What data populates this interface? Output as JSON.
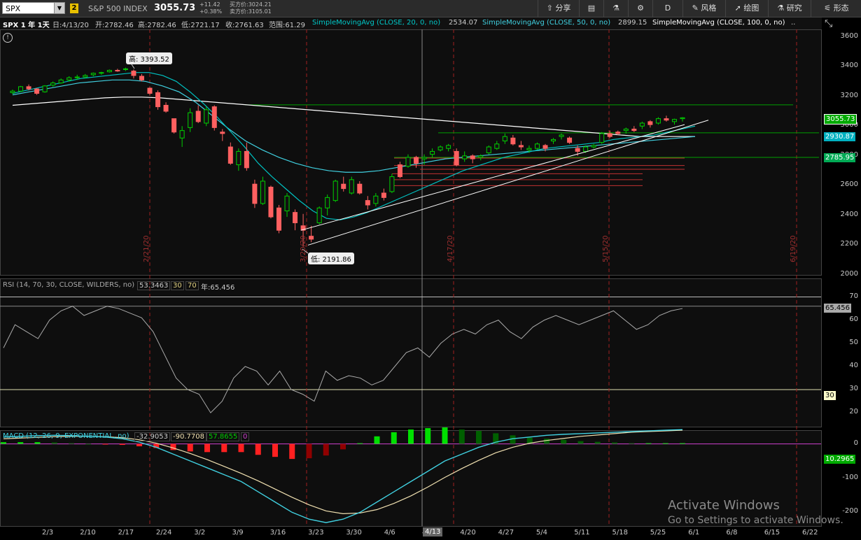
{
  "toolbar": {
    "symbol": "SPX",
    "link_badge": "2",
    "index_name": "S&P 500 INDEX",
    "last_price": "3055.73",
    "change": "+11.42",
    "change_pct": "+0.38%",
    "bid": "买方价:3024.21",
    "ask": "卖方价:3105.01",
    "share": "分享",
    "draw": "绘图",
    "pattern": "形态",
    "style": "风格",
    "research": "研究",
    "period": "D"
  },
  "header": {
    "title": "SPX 1 年 1天",
    "date": "日:4/13/20",
    "open": "开:2782.46",
    "high": "高:2782.46",
    "low": "低:2721.17",
    "close": "收:2761.63",
    "range": "范围:61.29",
    "sma20_label": "SimpleMovingAvg (CLOSE, 20, 0, no)",
    "sma20_value": "2534.07",
    "sma50_label": "SimpleMovingAvg (CLOSE, 50, 0, no)",
    "sma50_value": "2899.15",
    "sma100_label": "SimpleMovingAvg (CLOSE, 100, 0, no)",
    "more": ".."
  },
  "callouts": {
    "high": "高: 3393.52",
    "low": "低: 2191.86"
  },
  "price_axis": [
    "3600",
    "3400",
    "3200",
    "3000",
    "2800",
    "2600",
    "2400",
    "2200",
    "2000"
  ],
  "price_tags": {
    "last": "3055.73",
    "sma_a": "2930.87",
    "sma_b": "2785.95"
  },
  "event_dates": [
    "2/21/20",
    "3/20/20",
    "4/17/20",
    "5/15/20",
    "6/19/20"
  ],
  "rsi": {
    "label": "RSI (14, 70, 30, CLOSE, WILDERS, no)",
    "value": "53.3463",
    "os": "30",
    "ob": "70",
    "year": "年:65.456",
    "axis": [
      "70",
      "60",
      "50",
      "40",
      "30",
      "20"
    ],
    "tag_last": "65.456",
    "tag_os": "30"
  },
  "macd": {
    "label": "MACD (12, 26, 9, EXPONENTIAL, no)",
    "value": "-32.9053",
    "avg": "-90.7708",
    "diff": "57.8655",
    "zero": "0",
    "axis": [
      "0",
      "-100",
      "-200"
    ],
    "tag_last": "10.2965"
  },
  "x_axis": [
    "2/3",
    "2/10",
    "2/17",
    "2/24",
    "3/2",
    "3/9",
    "3/16",
    "3/23",
    "3/30",
    "4/6",
    "4/13",
    "4/20",
    "4/27",
    "5/4",
    "5/11",
    "5/18",
    "5/25",
    "6/1",
    "6/8",
    "6/15",
    "6/22"
  ],
  "watermark": {
    "line1": "Activate Windows",
    "line2": "Go to Settings to activate Windows."
  },
  "colors": {
    "up": "#00d000",
    "down": "#ff6060",
    "sma20": "#00c0c0",
    "sma50": "#40d0e0",
    "sma100": "#ffffff",
    "hline_green": "#00a000",
    "hline_red": "#c03030"
  },
  "chart_data": {
    "type": "candlestick",
    "ylim": [
      2000,
      3650
    ],
    "candles": [
      [
        3225,
        3245,
        3215,
        3235
      ],
      [
        3235,
        3270,
        3230,
        3265
      ],
      [
        3265,
        3280,
        3240,
        3250
      ],
      [
        3250,
        3255,
        3210,
        3220
      ],
      [
        3230,
        3275,
        3225,
        3270
      ],
      [
        3275,
        3300,
        3265,
        3290
      ],
      [
        3290,
        3320,
        3285,
        3310
      ],
      [
        3310,
        3335,
        3300,
        3325
      ],
      [
        3325,
        3345,
        3310,
        3330
      ],
      [
        3330,
        3350,
        3320,
        3340
      ],
      [
        3345,
        3360,
        3335,
        3355
      ],
      [
        3355,
        3365,
        3345,
        3360
      ],
      [
        3365,
        3380,
        3360,
        3375
      ],
      [
        3375,
        3385,
        3365,
        3370
      ],
      [
        3380,
        3393,
        3370,
        3385
      ],
      [
        3370,
        3380,
        3320,
        3340
      ],
      [
        3335,
        3350,
        3300,
        3310
      ],
      [
        3255,
        3260,
        3210,
        3220
      ],
      [
        3225,
        3240,
        3110,
        3130
      ],
      [
        3140,
        3160,
        3090,
        3100
      ],
      [
        3050,
        3050,
        2950,
        2960
      ],
      [
        2920,
        3000,
        2860,
        2970
      ],
      [
        2990,
        3120,
        2960,
        3090
      ],
      [
        3100,
        3140,
        3020,
        3030
      ],
      [
        3020,
        3130,
        3000,
        3110
      ],
      [
        3130,
        3140,
        2970,
        2990
      ],
      [
        2960,
        2980,
        2900,
        2950
      ],
      [
        2860,
        2890,
        2740,
        2750
      ],
      [
        2740,
        2850,
        2700,
        2830
      ],
      [
        2830,
        2890,
        2700,
        2720
      ],
      [
        2610,
        2640,
        2450,
        2480
      ],
      [
        2480,
        2660,
        2470,
        2630
      ],
      [
        2590,
        2600,
        2380,
        2390
      ],
      [
        2450,
        2470,
        2280,
        2300
      ],
      [
        2430,
        2550,
        2390,
        2530
      ],
      [
        2420,
        2440,
        2300,
        2350
      ],
      [
        2330,
        2410,
        2190,
        2300
      ],
      [
        2260,
        2330,
        2220,
        2240
      ],
      [
        2350,
        2460,
        2340,
        2450
      ],
      [
        2450,
        2540,
        2400,
        2520
      ],
      [
        2500,
        2640,
        2490,
        2630
      ],
      [
        2610,
        2660,
        2560,
        2580
      ],
      [
        2550,
        2660,
        2540,
        2640
      ],
      [
        2610,
        2630,
        2540,
        2550
      ],
      [
        2500,
        2530,
        2440,
        2470
      ],
      [
        2480,
        2550,
        2460,
        2530
      ],
      [
        2550,
        2580,
        2500,
        2520
      ],
      [
        2560,
        2680,
        2550,
        2660
      ],
      [
        2740,
        2760,
        2650,
        2660
      ],
      [
        2730,
        2810,
        2720,
        2790
      ],
      [
        2790,
        2800,
        2720,
        2750
      ],
      [
        2780,
        2810,
        2740,
        2790
      ],
      [
        2810,
        2850,
        2790,
        2830
      ],
      [
        2840,
        2870,
        2830,
        2860
      ],
      [
        2850,
        2880,
        2830,
        2870
      ],
      [
        2830,
        2850,
        2730,
        2740
      ],
      [
        2780,
        2830,
        2760,
        2800
      ],
      [
        2800,
        2810,
        2750,
        2780
      ],
      [
        2790,
        2810,
        2770,
        2800
      ],
      [
        2820,
        2870,
        2810,
        2860
      ],
      [
        2850,
        2900,
        2840,
        2880
      ],
      [
        2900,
        2950,
        2880,
        2930
      ],
      [
        2920,
        2940,
        2870,
        2880
      ],
      [
        2870,
        2900,
        2840,
        2860
      ],
      [
        2840,
        2870,
        2820,
        2850
      ],
      [
        2850,
        2890,
        2840,
        2880
      ],
      [
        2870,
        2880,
        2830,
        2850
      ],
      [
        2900,
        2920,
        2880,
        2910
      ],
      [
        2930,
        2950,
        2910,
        2940
      ],
      [
        2920,
        2930,
        2880,
        2890
      ],
      [
        2850,
        2870,
        2800,
        2830
      ],
      [
        2830,
        2870,
        2820,
        2860
      ],
      [
        2860,
        2880,
        2850,
        2870
      ],
      [
        2890,
        2960,
        2880,
        2950
      ],
      [
        2950,
        2970,
        2920,
        2930
      ],
      [
        2960,
        2970,
        2940,
        2950
      ],
      [
        2970,
        2990,
        2950,
        2980
      ],
      [
        2980,
        3000,
        2960,
        2970
      ],
      [
        3000,
        3030,
        2980,
        3020
      ],
      [
        3030,
        3040,
        2990,
        3010
      ],
      [
        3020,
        3060,
        3010,
        3050
      ],
      [
        3050,
        3070,
        3030,
        3040
      ],
      [
        3030,
        3050,
        3010,
        3045
      ],
      [
        3050,
        3060,
        3030,
        3056
      ]
    ],
    "sma20": [
      3220,
      3240,
      3260,
      3280,
      3300,
      3320,
      3330,
      3340,
      3350,
      3360,
      3360,
      3340,
      3300,
      3230,
      3150,
      3060,
      2960,
      2860,
      2750,
      2660,
      2580,
      2500,
      2430,
      2380,
      2370,
      2390,
      2420,
      2460,
      2500,
      2540,
      2580,
      2620,
      2660,
      2700,
      2730,
      2760,
      2790,
      2810,
      2830,
      2850,
      2860,
      2870,
      2880,
      2890,
      2910,
      2920,
      2930,
      2940,
      2960,
      2980,
      3000
    ],
    "sma50": [
      3210,
      3230,
      3250,
      3270,
      3290,
      3300,
      3310,
      3310,
      3300,
      3270,
      3230,
      3160,
      3070,
      2980,
      2900,
      2840,
      2790,
      2750,
      2720,
      2700,
      2690,
      2690,
      2700,
      2720,
      2740,
      2760,
      2780,
      2790,
      2800,
      2810,
      2820,
      2830,
      2840,
      2850,
      2860,
      2870,
      2880,
      2890,
      2900,
      2910,
      2920,
      2930
    ],
    "sma100": [
      3140,
      3150,
      3160,
      3170,
      3180,
      3190,
      3195,
      3195,
      3190,
      3180,
      3170,
      3160,
      3150,
      3140,
      3130,
      3120,
      3110,
      3100,
      3090,
      3080,
      3070,
      3060,
      3050,
      3040,
      3030,
      3020,
      3010,
      3000,
      2990,
      2980,
      2970,
      2960,
      2950,
      2940,
      2930,
      2930,
      2930,
      2930
    ],
    "hlines_green": [
      3143,
      2955,
      2790
    ],
    "hlines_red": [
      2790,
      2735,
      2710,
      2680,
      2640,
      2600
    ],
    "rsi": [
      48,
      58,
      55,
      52,
      60,
      64,
      66,
      62,
      64,
      66,
      65,
      63,
      61,
      55,
      45,
      35,
      30,
      28,
      20,
      25,
      35,
      40,
      38,
      32,
      38,
      30,
      28,
      25,
      38,
      34,
      36,
      35,
      32,
      34,
      40,
      46,
      48,
      44,
      50,
      54,
      56,
      54,
      58,
      60,
      55,
      52,
      57,
      60,
      62,
      60,
      58,
      60,
      62,
      64,
      60,
      56,
      58,
      62,
      64,
      65
    ],
    "macd_line": [
      20,
      22,
      24,
      25,
      24,
      22,
      20,
      15,
      5,
      -10,
      -30,
      -50,
      -70,
      -90,
      -110,
      -140,
      -170,
      -200,
      -220,
      -230,
      -220,
      -200,
      -170,
      -140,
      -110,
      -80,
      -50,
      -30,
      -10,
      5,
      15,
      20,
      25,
      28,
      30,
      32,
      34,
      36,
      38,
      40,
      42
    ],
    "macd_signal": [
      15,
      17,
      19,
      21,
      22,
      22,
      21,
      18,
      12,
      2,
      -12,
      -28,
      -46,
      -66,
      -86,
      -108,
      -132,
      -156,
      -178,
      -196,
      -204,
      -202,
      -192,
      -174,
      -152,
      -126,
      -98,
      -72,
      -48,
      -26,
      -10,
      2,
      10,
      16,
      22,
      26,
      30,
      34,
      36,
      38,
      40
    ],
    "macd_hist": [
      5,
      5,
      5,
      4,
      2,
      0,
      -1,
      -3,
      -7,
      -12,
      -18,
      -22,
      -24,
      -24,
      -24,
      -32,
      -38,
      -44,
      -42,
      -34,
      -16,
      2,
      22,
      34,
      42,
      46,
      48,
      42,
      38,
      31,
      25,
      18,
      15,
      12,
      8,
      6,
      4,
      2,
      2,
      2,
      2
    ]
  }
}
